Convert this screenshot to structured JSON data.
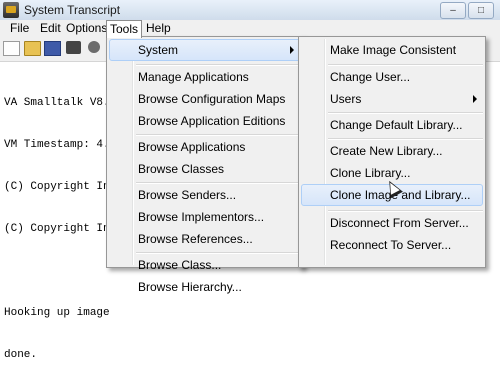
{
  "window": {
    "title": "System Transcript",
    "controls": [
      "–",
      "□"
    ]
  },
  "menubar": [
    "File",
    "Edit",
    "Options",
    "Tools",
    "Help"
  ],
  "toolbar": {
    "icons": [
      "new-file-icon",
      "open-folder-icon",
      "save-icon",
      "print-icon",
      "settings-icon"
    ]
  },
  "transcript": {
    "lines": [
      "VA Smalltalk V8.5.",
      "VM Timestamp: 4.0",
      "(C) Copyright Insta",
      "(C) Copyright Intern",
      "",
      "Hooking up image",
      "done."
    ]
  },
  "tools_menu": {
    "items": [
      {
        "label": "System",
        "submenu": true,
        "highlighted": true
      },
      {
        "label": "Manage Applications"
      },
      {
        "label": "Browse Configuration Maps"
      },
      {
        "label": "Browse Application Editions"
      },
      {
        "label": "Browse Applications"
      },
      {
        "label": "Browse Classes"
      },
      {
        "label": "Browse Senders..."
      },
      {
        "label": "Browse Implementors..."
      },
      {
        "label": "Browse References..."
      },
      {
        "label": "Browse Class..."
      },
      {
        "label": "Browse Hierarchy..."
      }
    ]
  },
  "system_menu": {
    "items": [
      {
        "label": "Make Image Consistent"
      },
      {
        "label": "Change User..."
      },
      {
        "label": "Users",
        "submenu": true
      },
      {
        "label": "Change Default Library..."
      },
      {
        "label": "Create New Library..."
      },
      {
        "label": "Clone Library..."
      },
      {
        "label": "Clone Image and Library...",
        "highlighted": true
      },
      {
        "label": "Disconnect From Server..."
      },
      {
        "label": "Reconnect To Server..."
      }
    ]
  },
  "colors": {
    "highlight": "#d6e5fa",
    "highlight_border": "#aecff7",
    "menu_bg": "#f0f0f0"
  }
}
